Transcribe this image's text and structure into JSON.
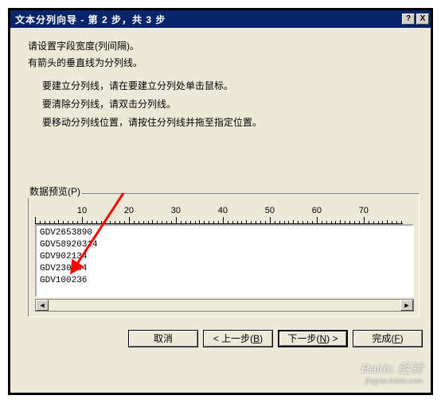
{
  "titlebar": {
    "title": "文本分列向导 - 第 2 步，共 3 步",
    "help": "?",
    "close": "X"
  },
  "instructions": {
    "line1": "请设置字段宽度(列间隔)。",
    "line2": "有箭头的垂直线为分列线。",
    "sub1": "要建立分列线，请在要建立分列处单击鼠标。",
    "sub2": "要清除分列线，请双击分列线。",
    "sub3": "要移动分列线位置，请按住分列线并拖至指定位置。"
  },
  "preview": {
    "label": "数据预览(P)",
    "ruler_ticks": [
      10,
      20,
      30,
      40,
      50,
      60,
      70
    ],
    "rows": [
      "GDV2653890",
      "GDV58920314",
      "GDV902134",
      "GDV230164",
      "GDV100236"
    ]
  },
  "buttons": {
    "cancel": "取消",
    "back_prefix": "< 上一步(",
    "back_u": "B",
    "back_suffix": ")",
    "next_prefix": "下一步(",
    "next_u": "N",
    "next_suffix": ") >",
    "finish_prefix": "完成(",
    "finish_u": "F",
    "finish_suffix": ")"
  },
  "watermark": {
    "main": "Baidu 经验",
    "sub": "jingyan.baidu.com"
  }
}
